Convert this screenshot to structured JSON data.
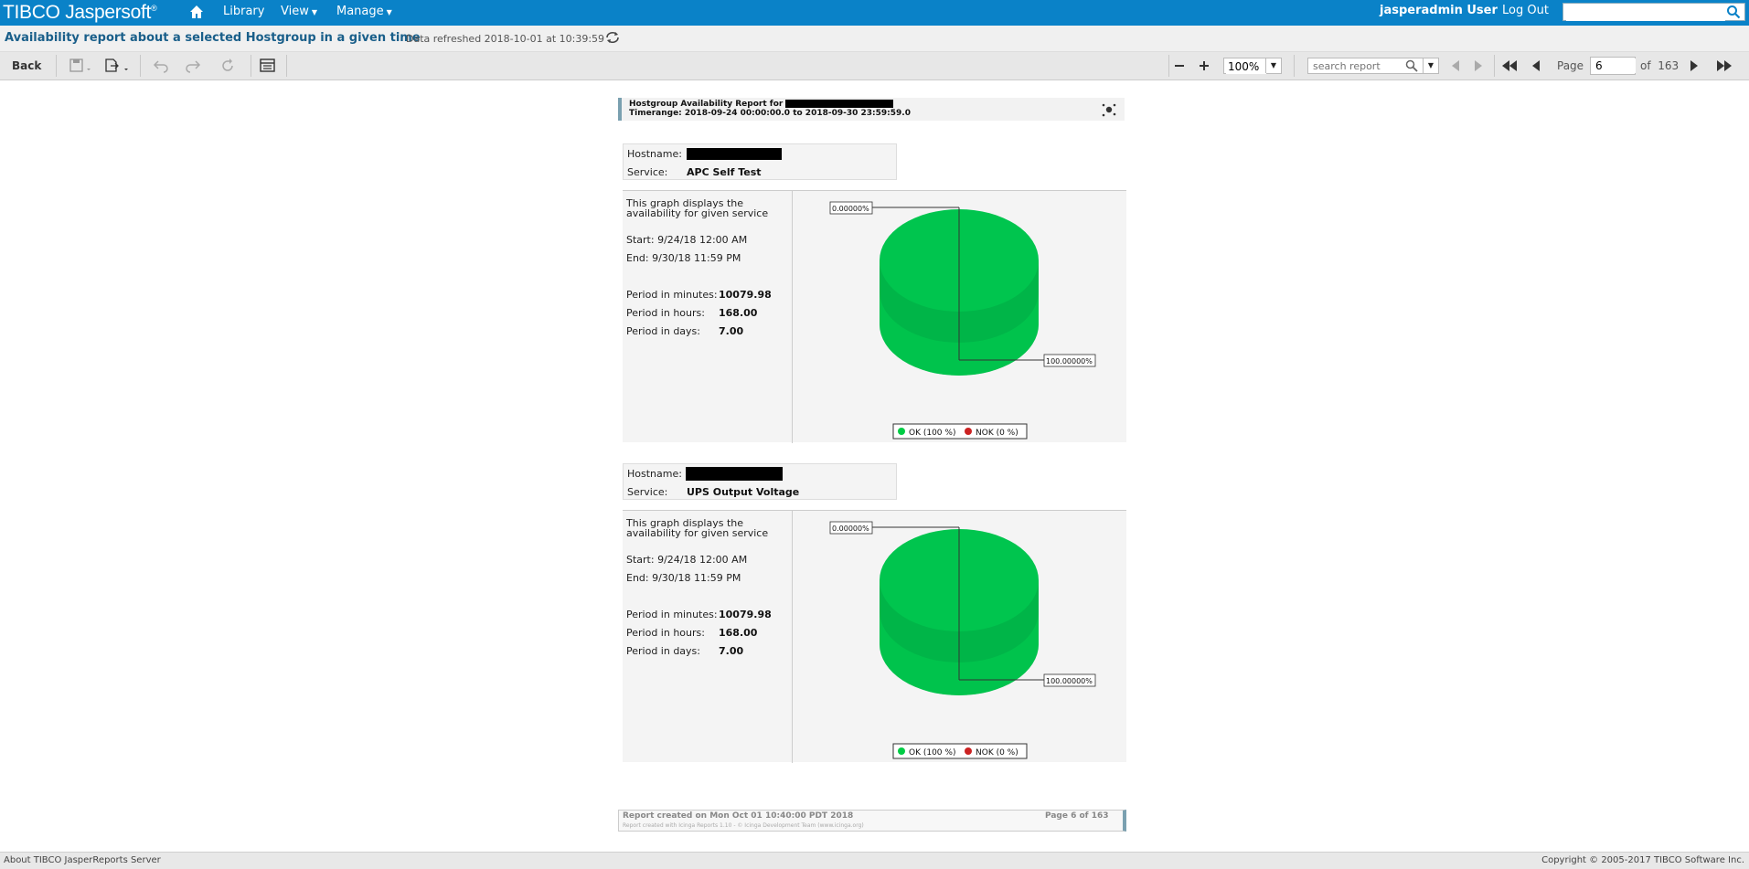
{
  "topbar": {
    "logo": "TIBCO Jaspersoft",
    "logo_mark": "®",
    "nav": [
      "Library",
      "View",
      "Manage"
    ],
    "user": "jasperadmin User",
    "logout": "Log Out",
    "search_value": ""
  },
  "titlebar": {
    "title": "Availability report about a selected Hostgroup in a given time",
    "refreshed": "Data refreshed 2018-10-01 at 10:39:59"
  },
  "toolbar": {
    "back": "Back",
    "zoom": "100%",
    "search_placeholder": "search report",
    "page_label": "Page",
    "page_value": "6",
    "of_label": "of",
    "total_pages": "163"
  },
  "report": {
    "header_line1": "Hostgroup Availability Report for",
    "header_line2": "Timerange: 2018-09-24 00:00:00.0 to 2018-09-30 23:59:59.0",
    "sections": [
      {
        "hostname_label": "Hostname:",
        "service_label": "Service:",
        "service": "APC Self Test",
        "desc_line1": "This graph displays the",
        "desc_line2": "availability for given service",
        "start": "Start: 9/24/18 12:00 AM",
        "end": "End:  9/30/18 11:59 PM",
        "minutes_label": "Period in minutes:",
        "minutes": "10079.98",
        "hours_label": "Period in hours:",
        "hours": "168.00",
        "days_label": "Period in days:",
        "days": "7.00",
        "label_nok": "0.00000%",
        "label_ok": "100.00000%",
        "legend_ok": "OK (100 %)",
        "legend_nok": "NOK (0 %)"
      },
      {
        "hostname_label": "Hostname:",
        "service_label": "Service:",
        "service": "UPS Output Voltage",
        "desc_line1": "This graph displays the",
        "desc_line2": "availability for given service",
        "start": "Start: 9/24/18 12:00 AM",
        "end": "End:  9/30/18 11:59 PM",
        "minutes_label": "Period in minutes:",
        "minutes": "10079.98",
        "hours_label": "Period in hours:",
        "hours": "168.00",
        "days_label": "Period in days:",
        "days": "7.00",
        "label_nok": "0.00000%",
        "label_ok": "100.00000%",
        "legend_ok": "OK (100 %)",
        "legend_nok": "NOK (0 %)"
      }
    ],
    "footer_created": "Report created on Mon Oct 01 10:40:00 PDT 2018",
    "footer_small": "Report created with Icinga Reports 1.10 - © Icinga Development Team (www.icinga.org)",
    "footer_page": "Page 6 of 163"
  },
  "bottombar": {
    "about": "About TIBCO JasperReports Server",
    "copyright": "Copyright © 2005-2017 TIBCO Software Inc."
  },
  "colors": {
    "topbar": "#0a82c8",
    "ok": "#00cc44",
    "nok": "#cc2222"
  }
}
